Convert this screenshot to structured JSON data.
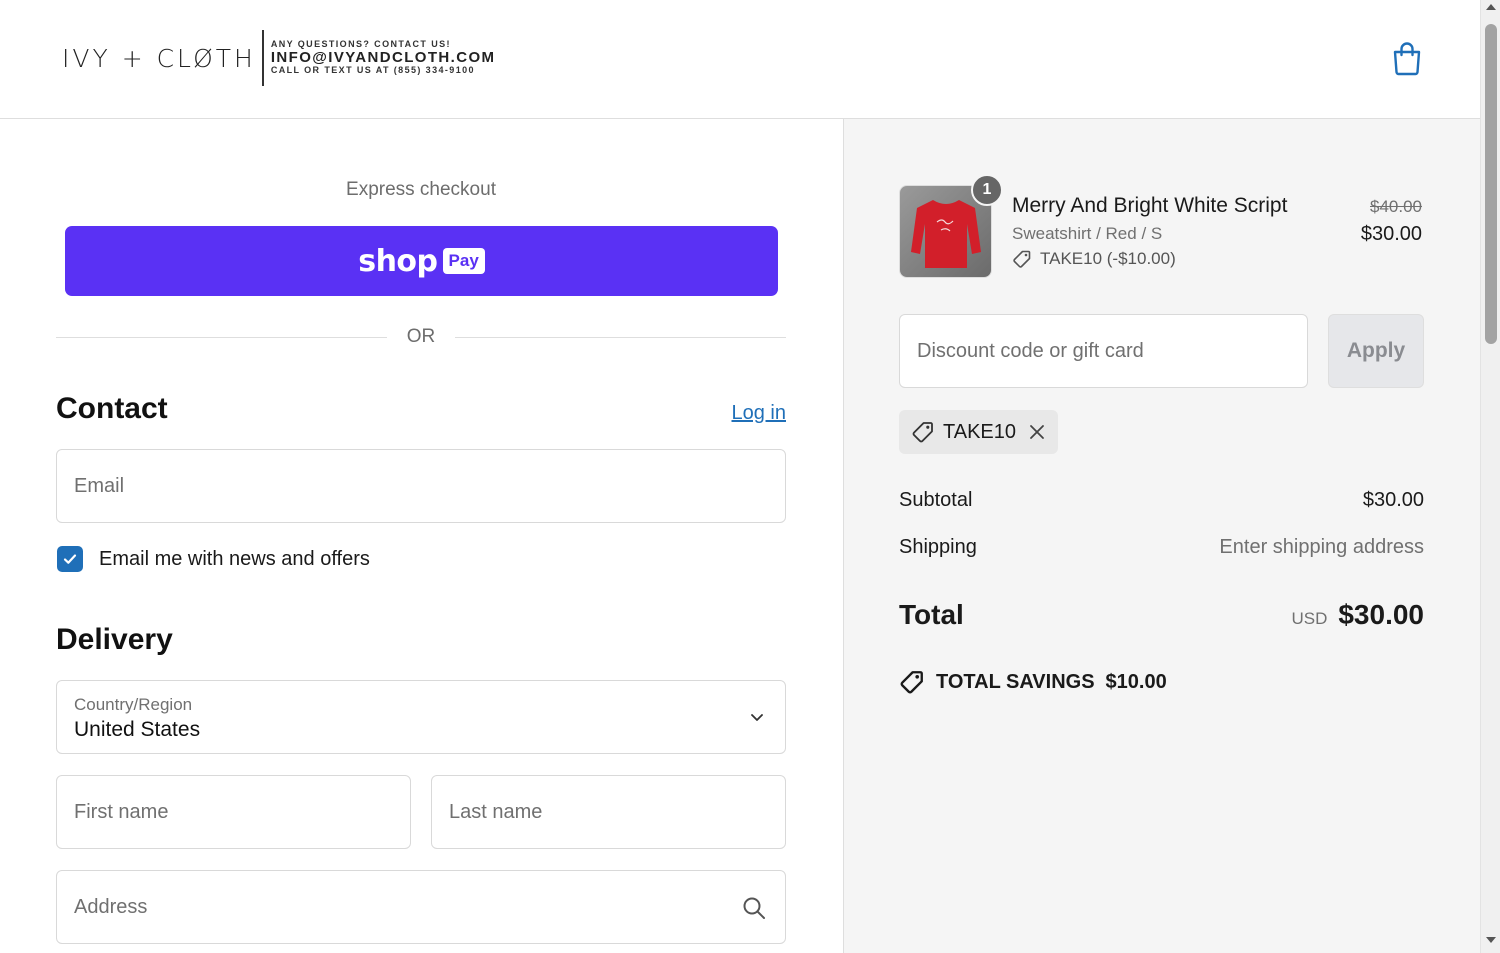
{
  "header": {
    "brand": "IVY + CLØTH",
    "info_line1": "ANY QUESTIONS? CONTACT US!",
    "info_line2": "INFO@IVYANDCLOTH.COM",
    "info_line3": "CALL OR TEXT US AT (855) 334-9100",
    "cart_icon": "shopping-bag-icon"
  },
  "checkout": {
    "express_label": "Express checkout",
    "shoppay_shop": "shop",
    "shoppay_pay": "Pay",
    "or_label": "OR",
    "contact": {
      "title": "Contact",
      "login_label": "Log in",
      "email_placeholder": "Email",
      "newsletter_label": "Email me with news and offers",
      "newsletter_checked": true
    },
    "delivery": {
      "title": "Delivery",
      "country_label": "Country/Region",
      "country_value": "United States",
      "first_name_placeholder": "First name",
      "last_name_placeholder": "Last name",
      "address_placeholder": "Address"
    }
  },
  "summary": {
    "item": {
      "quantity": "1",
      "name": "Merry And Bright White Script",
      "variant": "Sweatshirt / Red / S",
      "discount": "TAKE10 (-$10.00)",
      "original_price": "$40.00",
      "price": "$30.00"
    },
    "discount_placeholder": "Discount code or gift card",
    "apply_label": "Apply",
    "applied_code": "TAKE10",
    "subtotal_label": "Subtotal",
    "subtotal_value": "$30.00",
    "shipping_label": "Shipping",
    "shipping_value": "Enter shipping address",
    "total_label": "Total",
    "total_currency": "USD",
    "total_value": "$30.00",
    "savings_label": "TOTAL SAVINGS",
    "savings_value": "$10.00"
  },
  "colors": {
    "shoppay": "#5a31f4",
    "link": "#1f6fb8",
    "checkbox": "#1f6fb8",
    "summary_bg": "#f5f5f5"
  }
}
